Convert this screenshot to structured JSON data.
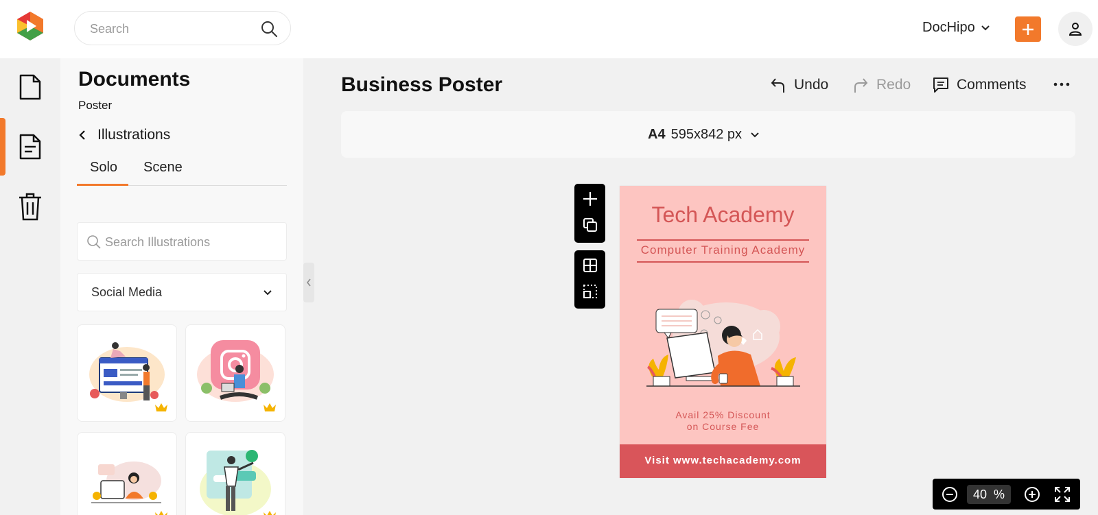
{
  "header": {
    "logo": "dochipo-logo",
    "search_placeholder": "Search",
    "account_name": "DocHipo",
    "brand_color": "#f2792b"
  },
  "rail": {
    "items": [
      {
        "icon": "document-icon",
        "active": false
      },
      {
        "icon": "documents-list-icon",
        "active": true
      },
      {
        "icon": "trash-icon",
        "active": false
      }
    ]
  },
  "panel": {
    "title": "Documents",
    "subtitle": "Poster",
    "back_label": "Illustrations",
    "tabs": [
      {
        "label": "Solo",
        "active": true
      },
      {
        "label": "Scene",
        "active": false
      }
    ],
    "search_placeholder": "Search Illustrations",
    "category": "Social Media",
    "thumbnails": [
      {
        "name": "social-dashboard-illustration",
        "premium": true
      },
      {
        "name": "instagram-illustration",
        "premium": true
      },
      {
        "name": "woman-computer-illustration",
        "premium": true
      },
      {
        "name": "whatsapp-illustration",
        "premium": true
      }
    ]
  },
  "editor": {
    "doc_title": "Business Poster",
    "undo_label": "Undo",
    "redo_label": "Redo",
    "comments_label": "Comments",
    "page_size_name": "A4",
    "page_size_dims": "595x842 px"
  },
  "poster": {
    "title": "Tech Academy",
    "subtitle": "Computer Training Academy",
    "offer_line1": "Avail 25% Discount",
    "offer_line2": "on Course Fee",
    "footer": "Visit www.techacademy.com",
    "bg_color": "#fdc5c1",
    "accent_color": "#d45656"
  },
  "zoom": {
    "value": "40",
    "unit": "%"
  }
}
